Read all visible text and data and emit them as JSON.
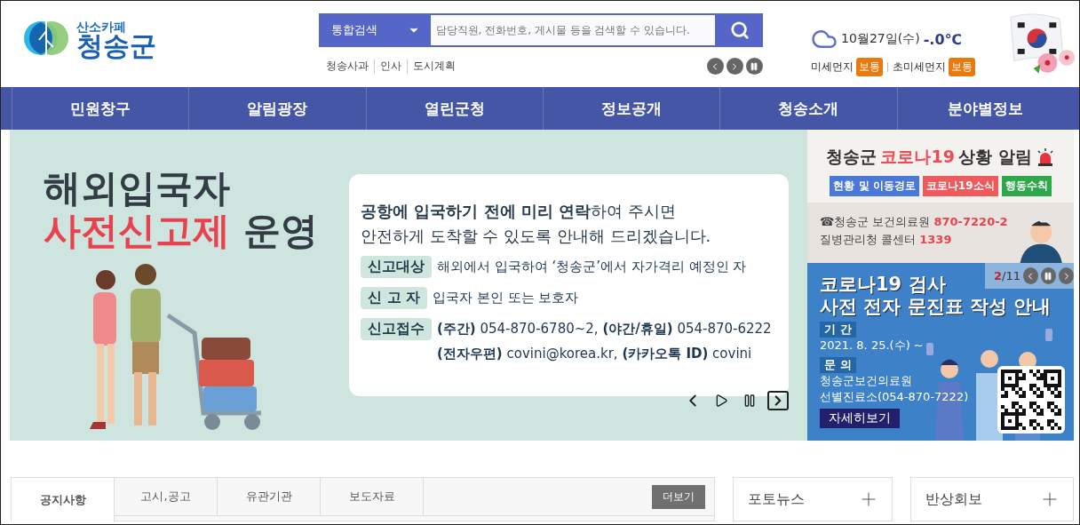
{
  "logo": {
    "tagline": "산소카페",
    "name": "청송군"
  },
  "search": {
    "scope": "통합검색",
    "placeholder": "담당직원, 전화번호, 게시물 등을 검색할 수 있습니다."
  },
  "quick_links": [
    "청송사과",
    "인사",
    "도시계획"
  ],
  "weather": {
    "date": "10월27일(수)",
    "temperature": "-.0℃",
    "air": [
      {
        "label": "미세먼지",
        "grade": "보통"
      },
      {
        "label": "초미세먼지",
        "grade": "보통"
      }
    ]
  },
  "nav": [
    "민원창구",
    "알림광장",
    "열린군청",
    "정보공개",
    "청송소개",
    "분야별정보"
  ],
  "main_banner": {
    "title": "해외입국자",
    "subtitle_accent": "사전신고제",
    "subtitle_rest": "운영",
    "intro": [
      "**공항에 입국하기 전에 미리 연락**하여 주시면",
      "안전하게 도착할 수 있도록 안내해 드리겠습니다."
    ],
    "rows": [
      {
        "label": "신고대상",
        "lines": [
          "해외에서 입국하여 ‘청송군’에서 자가격리 예정인 자"
        ]
      },
      {
        "label": "신 고 자",
        "lines": [
          "입국자 본인 또는 보호자"
        ]
      },
      {
        "label": "신고접수",
        "lines": [
          "**(주간)** 054-870-6780~2, **(야간/휴일)** 054-870-6222",
          "**(전자우편)** covini@korea.kr, **(카카오톡 ID)** covini"
        ]
      }
    ]
  },
  "corona": {
    "title_start": "청송군",
    "title_accent": "코로나19",
    "title_end": "상황 알림",
    "buttons": [
      {
        "label": "현황 및 이동경로",
        "color": "#4a78d8"
      },
      {
        "label": "코로나19소식",
        "color": "#ef5a5f"
      },
      {
        "label": "행동수칙",
        "color": "#2ea84a"
      }
    ],
    "hotlines": [
      {
        "name": "☎청송군 보건의료원",
        "number": "870-7220-2"
      },
      {
        "name": "질병관리청 콜센터",
        "number": "1339"
      }
    ]
  },
  "slide": {
    "current": "2",
    "total": "/11",
    "title": [
      "코로나19 검사",
      "사전 전자 문진표 작성 안내"
    ],
    "period_label": "기 간",
    "period": "2021. 8. 25.(수) ~",
    "contact_label": "문 의",
    "contact": [
      "청송군보건의료원",
      "선별진료소(054-870-7222)"
    ],
    "button": "자세히보기"
  },
  "board": {
    "tabs": [
      {
        "label": "공지사항",
        "selected": true
      },
      {
        "label": "고시,공고",
        "selected": false
      },
      {
        "label": "유관기관",
        "selected": false
      },
      {
        "label": "보도자료",
        "selected": false
      }
    ],
    "more": "더보기"
  },
  "side_boxes": [
    "포토뉴스",
    "반상회보"
  ]
}
